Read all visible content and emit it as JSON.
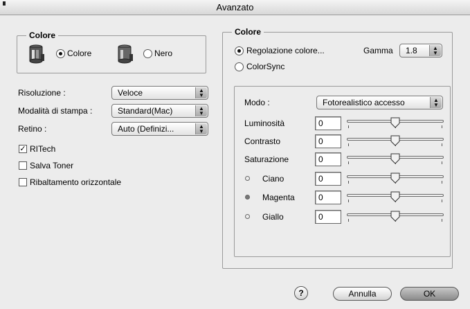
{
  "window": {
    "title": "Avanzato"
  },
  "left": {
    "color_group": {
      "title": "Colore",
      "color_option": "Colore",
      "black_option": "Nero",
      "selected": "color"
    },
    "settings": {
      "resolution": {
        "label": "Risoluzione :",
        "value": "Veloce"
      },
      "print_mode": {
        "label": "Modalità di stampa :",
        "value": "Standard(Mac)"
      },
      "halftone": {
        "label": "Retino :",
        "value": "Auto (Definizi..."
      }
    },
    "checkboxes": [
      {
        "label": "RITech",
        "checked": true
      },
      {
        "label": "Salva Toner",
        "checked": false
      },
      {
        "label": "Ribaltamento orizzontale",
        "checked": false
      }
    ]
  },
  "right": {
    "group_title": "Colore",
    "color_adjust_option": "Regolazione colore...",
    "colorsync_option": "ColorSync",
    "gamma": {
      "label": "Gamma",
      "value": "1.8"
    },
    "mode": {
      "label": "Modo :",
      "value": "Fotorealistico accesso"
    },
    "sliders": [
      {
        "label": "Luminosità",
        "value": "0",
        "dot": ""
      },
      {
        "label": "Contrasto",
        "value": "0",
        "dot": ""
      },
      {
        "label": "Saturazione",
        "value": "0",
        "dot": ""
      },
      {
        "label": "Ciano",
        "value": "0",
        "dot": "empty"
      },
      {
        "label": "Magenta",
        "value": "0",
        "dot": "filled"
      },
      {
        "label": "Giallo",
        "value": "0",
        "dot": "empty"
      }
    ]
  },
  "footer": {
    "help": "?",
    "cancel": "Annulla",
    "ok": "OK"
  }
}
